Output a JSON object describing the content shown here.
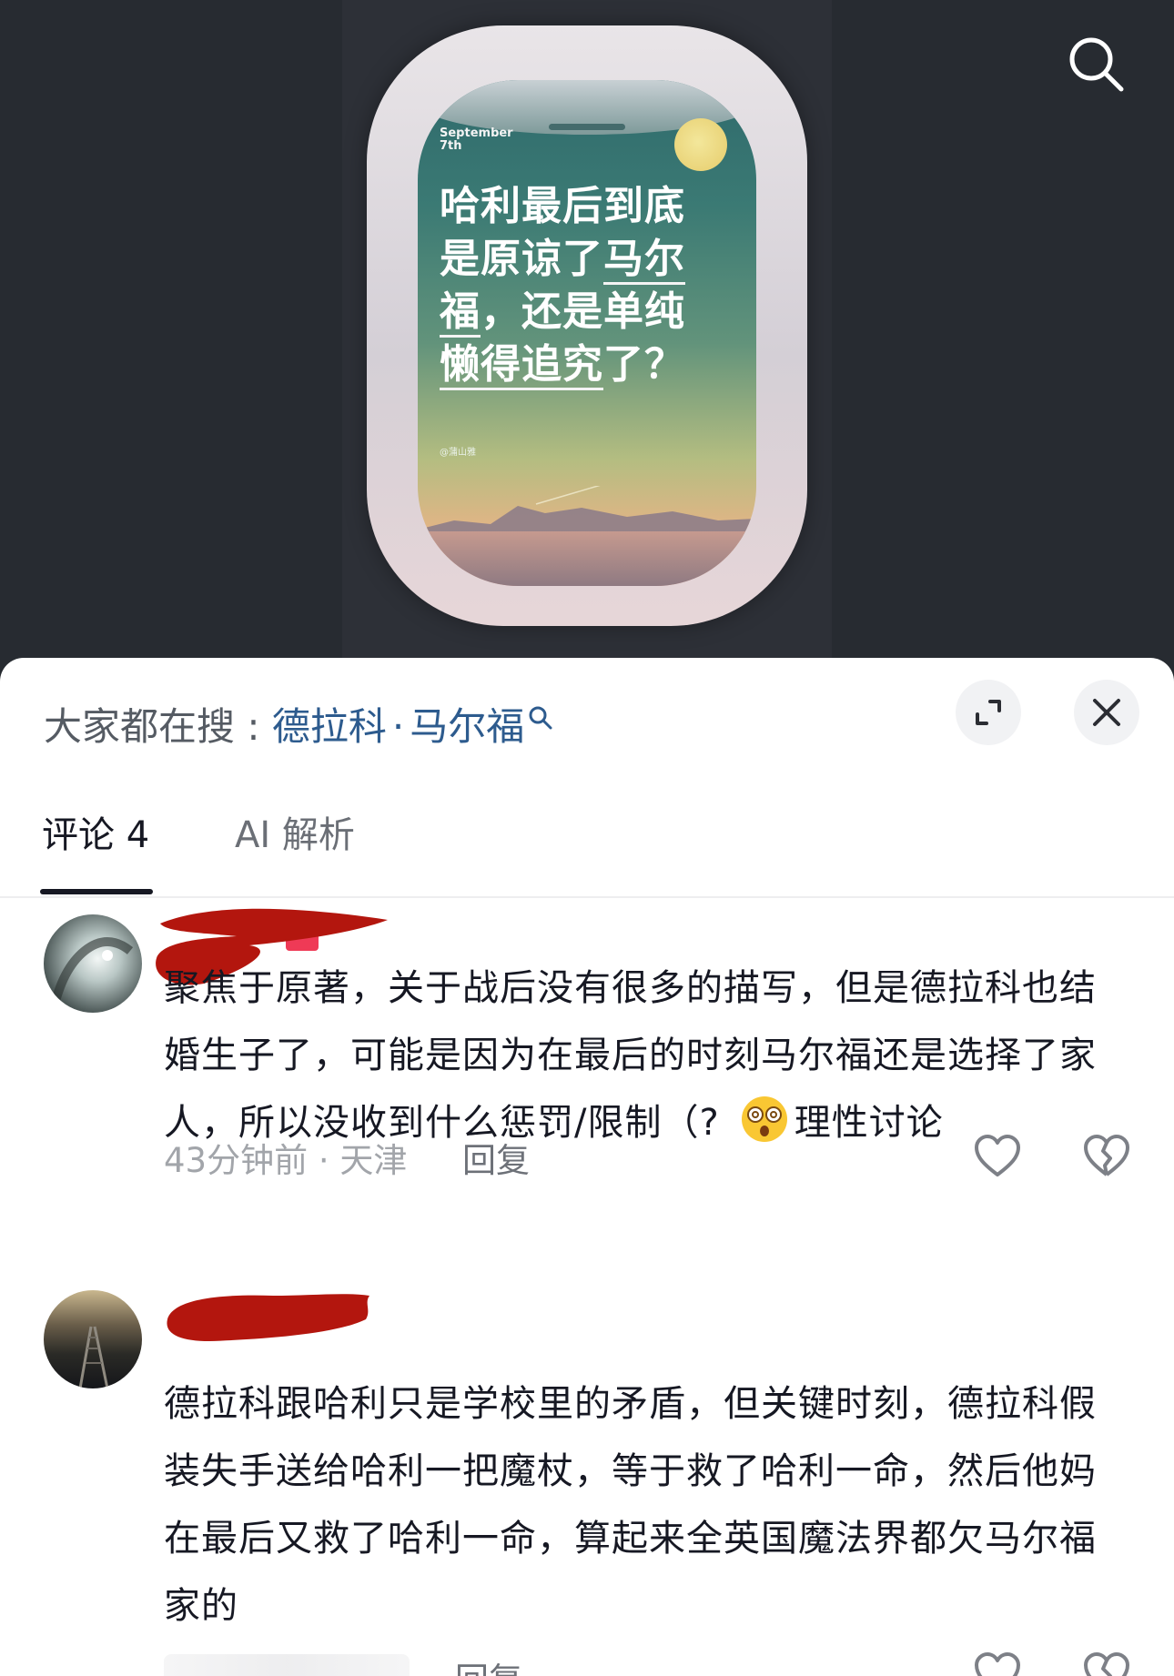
{
  "poster": {
    "date": "September\n7th",
    "title_lines": [
      "哈利最后到底",
      "是原谅了",
      "马尔",
      "福",
      "，还是单纯",
      "懒得追究",
      "了？"
    ],
    "handle": "@蒲山雅"
  },
  "search_icon": "search-icon",
  "sheet": {
    "trending_prefix": "大家都在搜 : ",
    "trending_term_1": "德拉科",
    "trending_separator": "·",
    "trending_term_2": "马尔福",
    "expand_icon": "expand-icon",
    "close_icon": "close-icon"
  },
  "tabs": {
    "comments": "评论 4",
    "ai": "AI 解析"
  },
  "comments": [
    {
      "text": "聚焦于原著，关于战后没有很多的描写，但是德拉科也结婚生子了，可能是因为在最后的时刻马尔福还是选择了家人，所以没收到什么惩罚/限制（?",
      "tag": "理性讨论",
      "time_location": "43分钟前 · 天津",
      "reply": "回复"
    },
    {
      "text": "德拉科跟哈利只是学校里的矛盾，但关键时刻，德拉科假装失手送给哈利一把魔杖，等于救了哈利一命，然后他妈在最后又救了哈利一命，算起来全英国魔法界都欠马尔福家的",
      "reply": "回复"
    }
  ],
  "colors": {
    "link": "#2d5b8e",
    "redaction": "#b3160e",
    "text": "#161823",
    "meta": "#a2a5aa"
  }
}
